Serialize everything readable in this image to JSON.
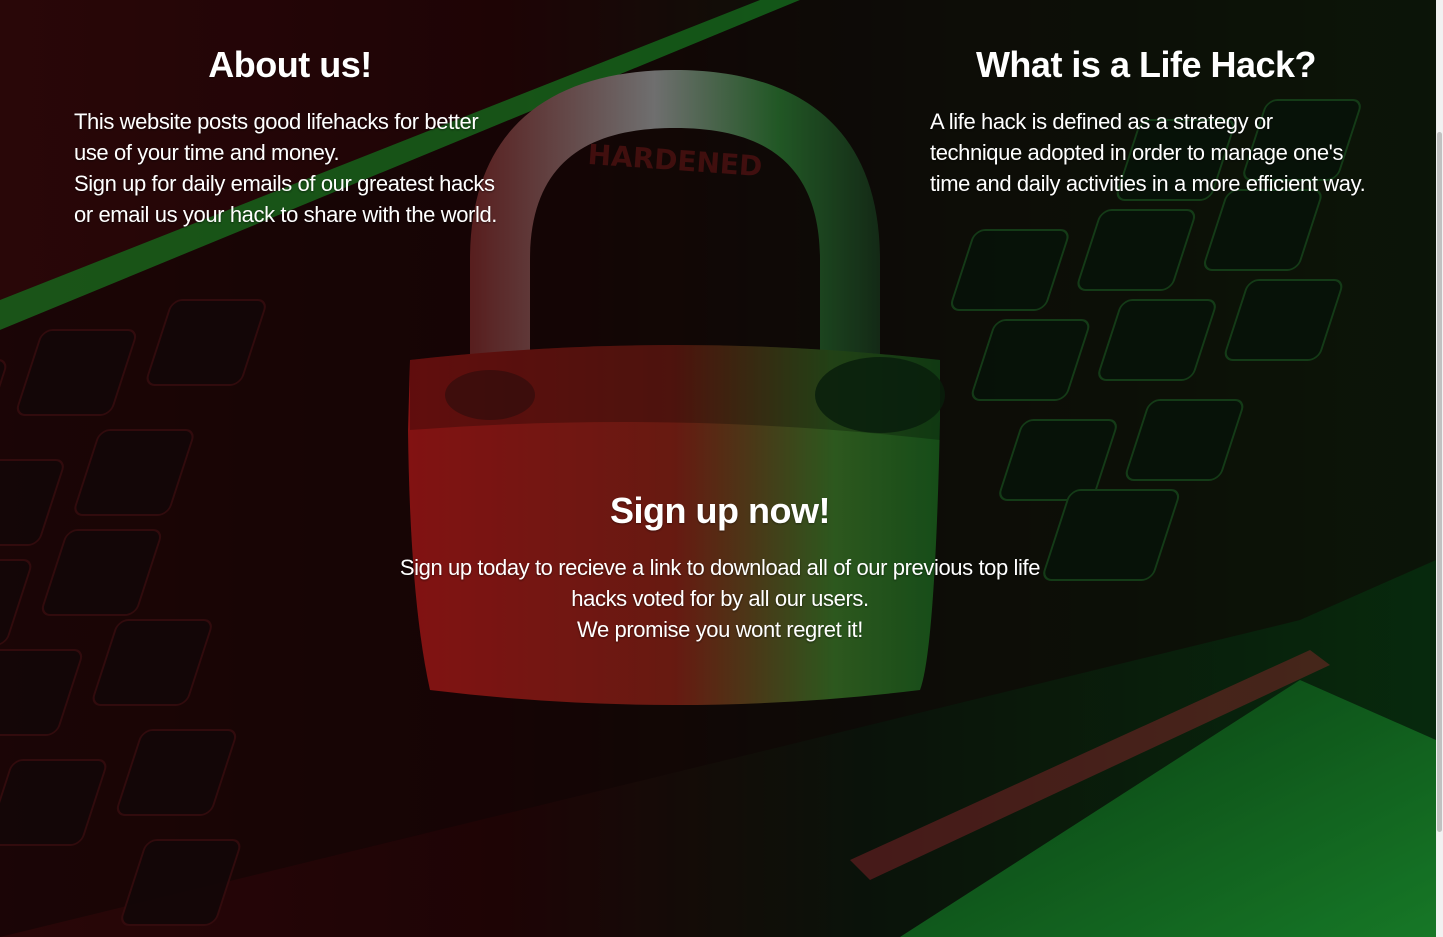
{
  "about": {
    "title": "About us!",
    "line1": "This website posts good lifehacks for better use of your time and money.",
    "line2": "Sign up for daily emails of our greatest hacks or email us your hack to share with the world."
  },
  "lifehack": {
    "title": "What is a Life Hack?",
    "text": "A life hack is defined as a strategy or technique adopted in order to manage one's time and daily activities in a more efficient way."
  },
  "signup": {
    "title": "Sign up now!",
    "line1": "Sign up today to recieve a link to download all of our previous top life hacks voted for by all our users.",
    "line2": "We promise you wont regret it!"
  },
  "background": {
    "image": "padlock-on-keyboard",
    "padlock_engraving": "HARDENED",
    "tint_colors": [
      "#c0161a",
      "#1fbf3a",
      "#0a0a0a"
    ]
  }
}
